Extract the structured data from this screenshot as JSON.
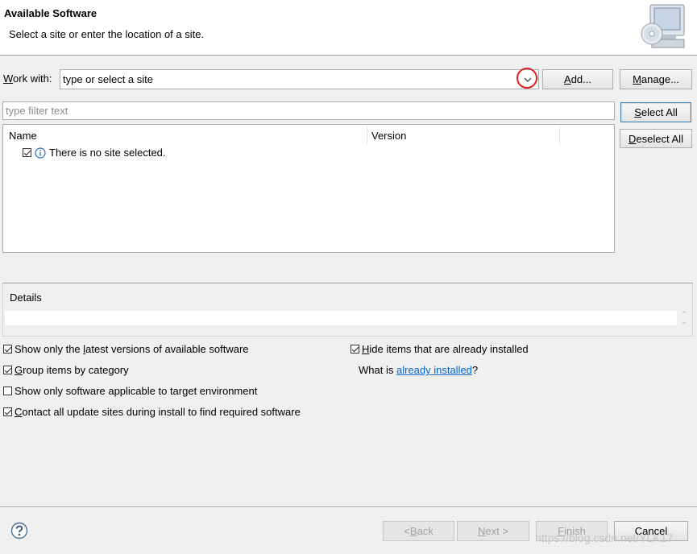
{
  "header": {
    "title": "Available Software",
    "subtitle": "Select a site or enter the location of a site."
  },
  "work_with": {
    "label_mnemonic": "W",
    "label_rest": "ork with:",
    "value": "type or select a site",
    "add_button_mnemonic": "A",
    "add_button_rest": "dd...",
    "manage_button_mnemonic": "M",
    "manage_button_rest": "anage..."
  },
  "filter": {
    "placeholder": "type filter text",
    "select_all_mnemonic": "S",
    "select_all_rest": "elect All",
    "deselect_all_mnemonic": "D",
    "deselect_all_rest": "eselect All"
  },
  "tree": {
    "columns": [
      "Name",
      "Version"
    ],
    "rows": [
      {
        "checked": true,
        "icon": "info-icon",
        "text": "There is no site selected."
      }
    ]
  },
  "details": {
    "label": "Details"
  },
  "options_left": [
    {
      "checked": true,
      "mnemonic": "",
      "pre": "Show only the ",
      "mn": "l",
      "post": "atest versions of available software"
    },
    {
      "checked": true,
      "mnemonic": "",
      "pre": "",
      "mn": "G",
      "post": "roup items by category"
    },
    {
      "checked": false,
      "mnemonic": "",
      "pre": "Show only software applicable to target environment",
      "mn": "",
      "post": ""
    },
    {
      "checked": true,
      "mnemonic": "",
      "pre": "",
      "mn": "C",
      "post": "ontact all update sites during install to find required software"
    }
  ],
  "options_right": {
    "hide_installed": {
      "checked": true,
      "mn": "H",
      "post": "ide items that are already installed"
    },
    "what_is_pre": "What is ",
    "what_is_link": "already installed",
    "what_is_post": "?"
  },
  "footer": {
    "help_icon": "help-icon",
    "back_label_pre": "< ",
    "back_mn": "B",
    "back_rest": "ack",
    "next_mn": "N",
    "next_rest": "ext >",
    "finish_mn": "F",
    "finish_rest": "inish",
    "cancel_label": "Cancel",
    "watermark": "https://blog.csdn.net/YLK17"
  },
  "colors": {
    "highlight_circle": "#e02020",
    "link": "#0066cc",
    "background": "#f0f0f0"
  }
}
